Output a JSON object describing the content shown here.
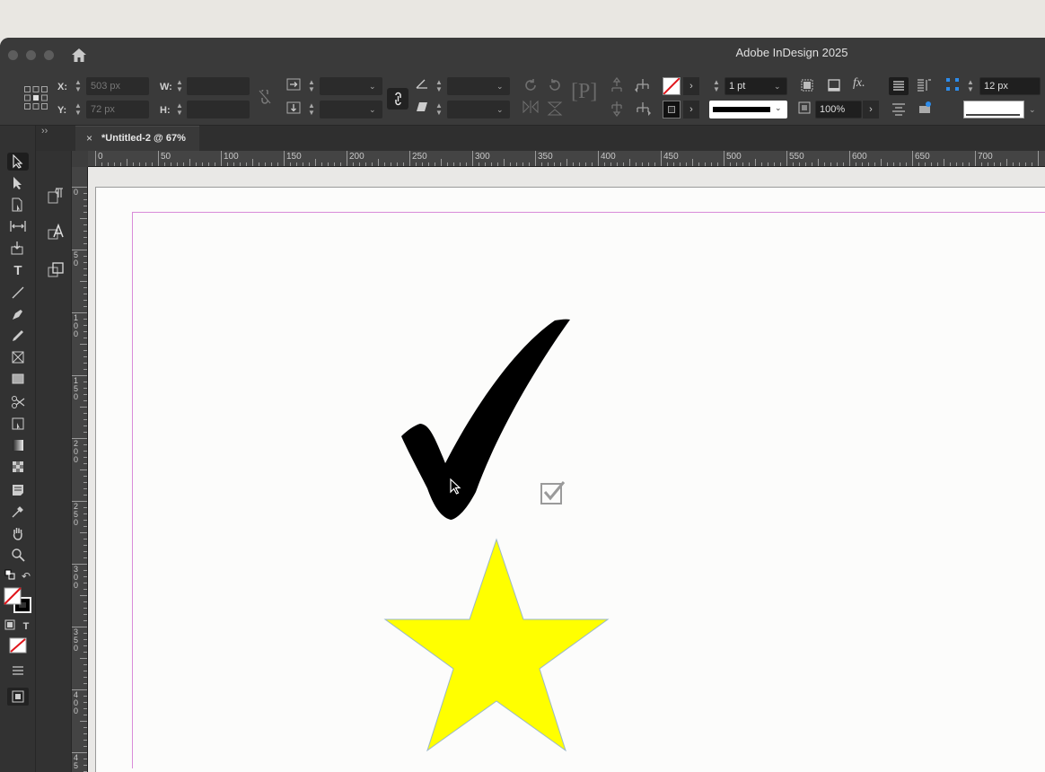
{
  "app": {
    "title": "Adobe InDesign 2025"
  },
  "control": {
    "x_label": "X:",
    "x_value": "503 px",
    "y_label": "Y:",
    "y_value": "72 px",
    "w_label": "W:",
    "h_label": "H:",
    "stroke_weight": "1 pt",
    "opacity": "100%",
    "gap": "12 px"
  },
  "document": {
    "tab_title": "*Untitled-2 @ 67%"
  },
  "ruler": {
    "h_ticks": [
      "0",
      "50",
      "100",
      "150",
      "200",
      "250",
      "300",
      "350",
      "400",
      "450",
      "500",
      "550",
      "600",
      "650",
      "700"
    ],
    "v_ticks": [
      "0",
      "5 0",
      "1 0 0",
      "1 5 0",
      "2 0 0",
      "2 5 0",
      "3 0 0",
      "3 5 0",
      "4 0 0",
      "4 5"
    ]
  },
  "colors": {
    "star_fill": "#ffff00",
    "check_fill": "#000000",
    "margin_guide": "#d98bd9"
  },
  "icons": [
    "apple-icon",
    "home-icon",
    "reference-point-icon",
    "link-icon",
    "rotate-icon",
    "flip-icon",
    "fill-none-icon",
    "stroke-swatch-icon",
    "fx-icon",
    "align-icon",
    "selection-tool-icon",
    "type-tool-icon",
    "zoom-tool-icon",
    "checkbox-icon"
  ]
}
